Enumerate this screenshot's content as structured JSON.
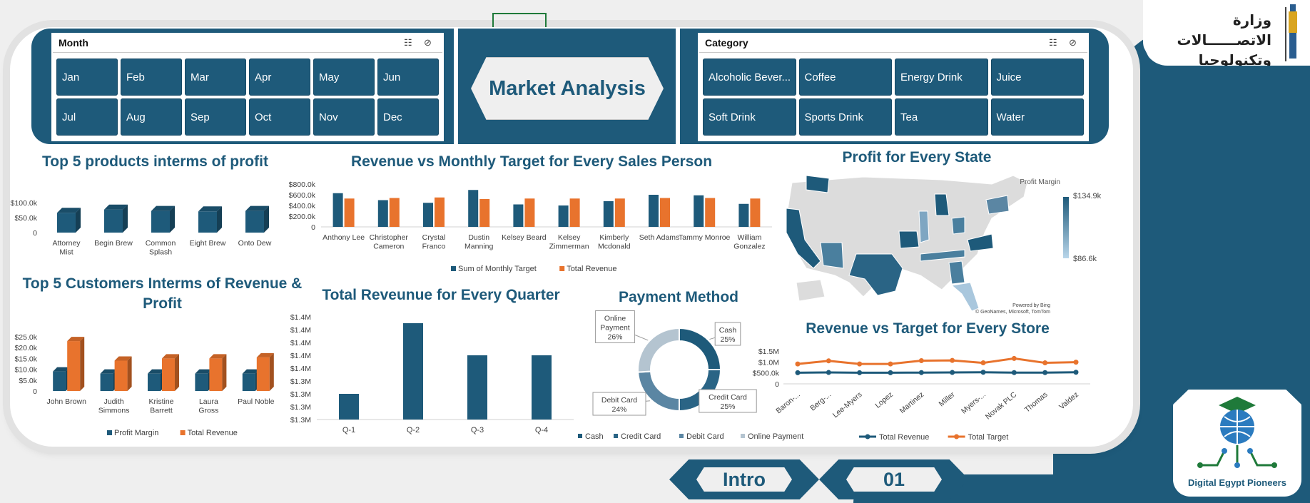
{
  "colors": {
    "navy": "#1e5a7a",
    "orange": "#e8732d",
    "light_blue": "#a9c7dd",
    "grey": "#bfbfbf"
  },
  "slicers": {
    "month": {
      "title": "Month",
      "items": [
        "Jan",
        "Feb",
        "Mar",
        "Apr",
        "May",
        "Jun",
        "Jul",
        "Aug",
        "Sep",
        "Oct",
        "Nov",
        "Dec"
      ]
    },
    "category": {
      "title": "Category",
      "items": [
        "Alcoholic Bever...",
        "Coffee",
        "Energy Drink",
        "Juice",
        "Soft Drink",
        "Sports Drink",
        "Tea",
        "Water"
      ]
    }
  },
  "dashboard_title": "Market Analysis",
  "titles": {
    "top_products": "Top 5 products interms of profit",
    "sales_person": "Revenue vs Monthly Target for Every Sales Person",
    "profit_state": "Profit for Every State",
    "top_customers": "Top 5 Customers Interms of Revenue & Profit",
    "quarter": "Total Reveunue for Every Quarter",
    "payment": "Payment Method",
    "store": "Revenue vs Target for Every Store"
  },
  "map": {
    "legend_title": "Profit Margin",
    "legend_max": "$134.9k",
    "legend_min": "$86.6k",
    "attribution_1": "Powered by Bing",
    "attribution_2": "© GeoNames, Microsoft, TomTom"
  },
  "logos": {
    "ministry_line1": "وزارة الاتصــــــالات",
    "ministry_line2": "وتكنولوجيا المعلومات",
    "dep": "Digital Egypt Pioneers"
  },
  "nav": {
    "intro": "Intro",
    "page": "01"
  },
  "chart_data": [
    {
      "id": "top_products",
      "type": "bar",
      "title": "Top 5 products interms of profit",
      "categories": [
        "Attorney Mist",
        "Begin Brew",
        "Common Splash",
        "Eight Brew",
        "Onto Dew"
      ],
      "tick_labels": [
        "$100.0k",
        "$50.0k",
        "0"
      ],
      "ylim": [
        0,
        130000
      ],
      "series": [
        {
          "values": [
            86000,
            100000,
            94000,
            92000,
            94000
          ],
          "color": "#1e5a7a"
        }
      ]
    },
    {
      "id": "sales_person",
      "type": "bar",
      "title": "Revenue vs Monthly Target for Every Sales Person",
      "categories": [
        "Anthony Lee",
        "Christopher Cameron",
        "Crystal Franco",
        "Dustin Manning",
        "Kelsey Beard",
        "Kelsey Zimmerman",
        "Kimberly Mcdonald",
        "Seth Adams",
        "Tammy Monroe",
        "William Gonzalez"
      ],
      "tick_labels": [
        "$800.0k",
        "$600.0k",
        "$400.0k",
        "$200.0k",
        "0"
      ],
      "ylim": [
        0,
        800000
      ],
      "legend": "bottom",
      "series": [
        {
          "name": "Sum of Monthly Target",
          "color": "#1e5a7a",
          "values": [
            630000,
            500000,
            450000,
            690000,
            420000,
            400000,
            480000,
            600000,
            590000,
            430000
          ]
        },
        {
          "name": "Total Revenue",
          "color": "#e8732d",
          "values": [
            530000,
            540000,
            550000,
            520000,
            530000,
            530000,
            530000,
            540000,
            540000,
            530000
          ]
        }
      ]
    },
    {
      "id": "top_customers",
      "type": "bar",
      "title": "Top 5 Customers Interms of Revenue & Profit",
      "categories": [
        "John Brown",
        "Judith Simmons",
        "Kristine Barrett",
        "Laura Gross",
        "Paul Noble"
      ],
      "tick_labels": [
        "$25.0k",
        "$20.0k",
        "$15.0k",
        "$10.0k",
        "$5.0k",
        "0"
      ],
      "ylim": [
        0,
        25000
      ],
      "legend": "bottom",
      "series": [
        {
          "name": "Profit Margin",
          "color": "#1e5a7a",
          "values": [
            9000,
            8000,
            8000,
            8000,
            8000
          ]
        },
        {
          "name": "Total Revenue",
          "color": "#e8732d",
          "values": [
            23000,
            14000,
            15000,
            15000,
            15500
          ]
        }
      ]
    },
    {
      "id": "quarter",
      "type": "bar",
      "title": "Total Reveunue for Every Quarter",
      "categories": [
        "Q-1",
        "Q-2",
        "Q-3",
        "Q-4"
      ],
      "tick_labels": [
        "$1.4M",
        "$1.4M",
        "$1.4M",
        "$1.4M",
        "$1.4M",
        "$1.3M",
        "$1.3M",
        "$1.3M",
        "$1.3M"
      ],
      "ylim": [
        1270000,
        1430000
      ],
      "series": [
        {
          "values": [
            1310000,
            1420000,
            1370000,
            1370000
          ],
          "color": "#1e5a7a"
        }
      ]
    },
    {
      "id": "payment",
      "type": "pie",
      "title": "Payment Method",
      "legend": "bottom",
      "slices": [
        {
          "name": "Cash",
          "value": 25,
          "label": "Cash\n25%",
          "color": "#1e5a7a"
        },
        {
          "name": "Credit Card",
          "value": 25,
          "label": "Credit Card\n25%",
          "color": "#2a6485"
        },
        {
          "name": "Debit Card",
          "value": 24,
          "label": "Debit Card\n24%",
          "color": "#5b86a3"
        },
        {
          "name": "Online Payment",
          "value": 26,
          "label": "Online\nPayment\n26%",
          "color": "#b4c4d0"
        }
      ]
    },
    {
      "id": "store",
      "type": "line",
      "title": "Revenue vs Target for Every Store",
      "categories": [
        "Baron-...",
        "Berg-...",
        "Lee-Myers",
        "Lopez",
        "Martinez",
        "Miller",
        "Myers-...",
        "Novak PLC",
        "Thomas",
        "Valdez"
      ],
      "tick_labels": [
        "$1.5M",
        "$1.0M",
        "$500.0k",
        "0"
      ],
      "ylim": [
        0,
        1500000
      ],
      "legend": "bottom",
      "series": [
        {
          "name": "Total Revenue",
          "color": "#1e5a7a",
          "values": [
            510000,
            520000,
            510000,
            510000,
            515000,
            520000,
            530000,
            515000,
            515000,
            530000
          ]
        },
        {
          "name": "Total Target",
          "color": "#e8732d",
          "values": [
            910000,
            1050000,
            910000,
            910000,
            1060000,
            1070000,
            960000,
            1160000,
            960000,
            990000
          ]
        }
      ]
    }
  ]
}
